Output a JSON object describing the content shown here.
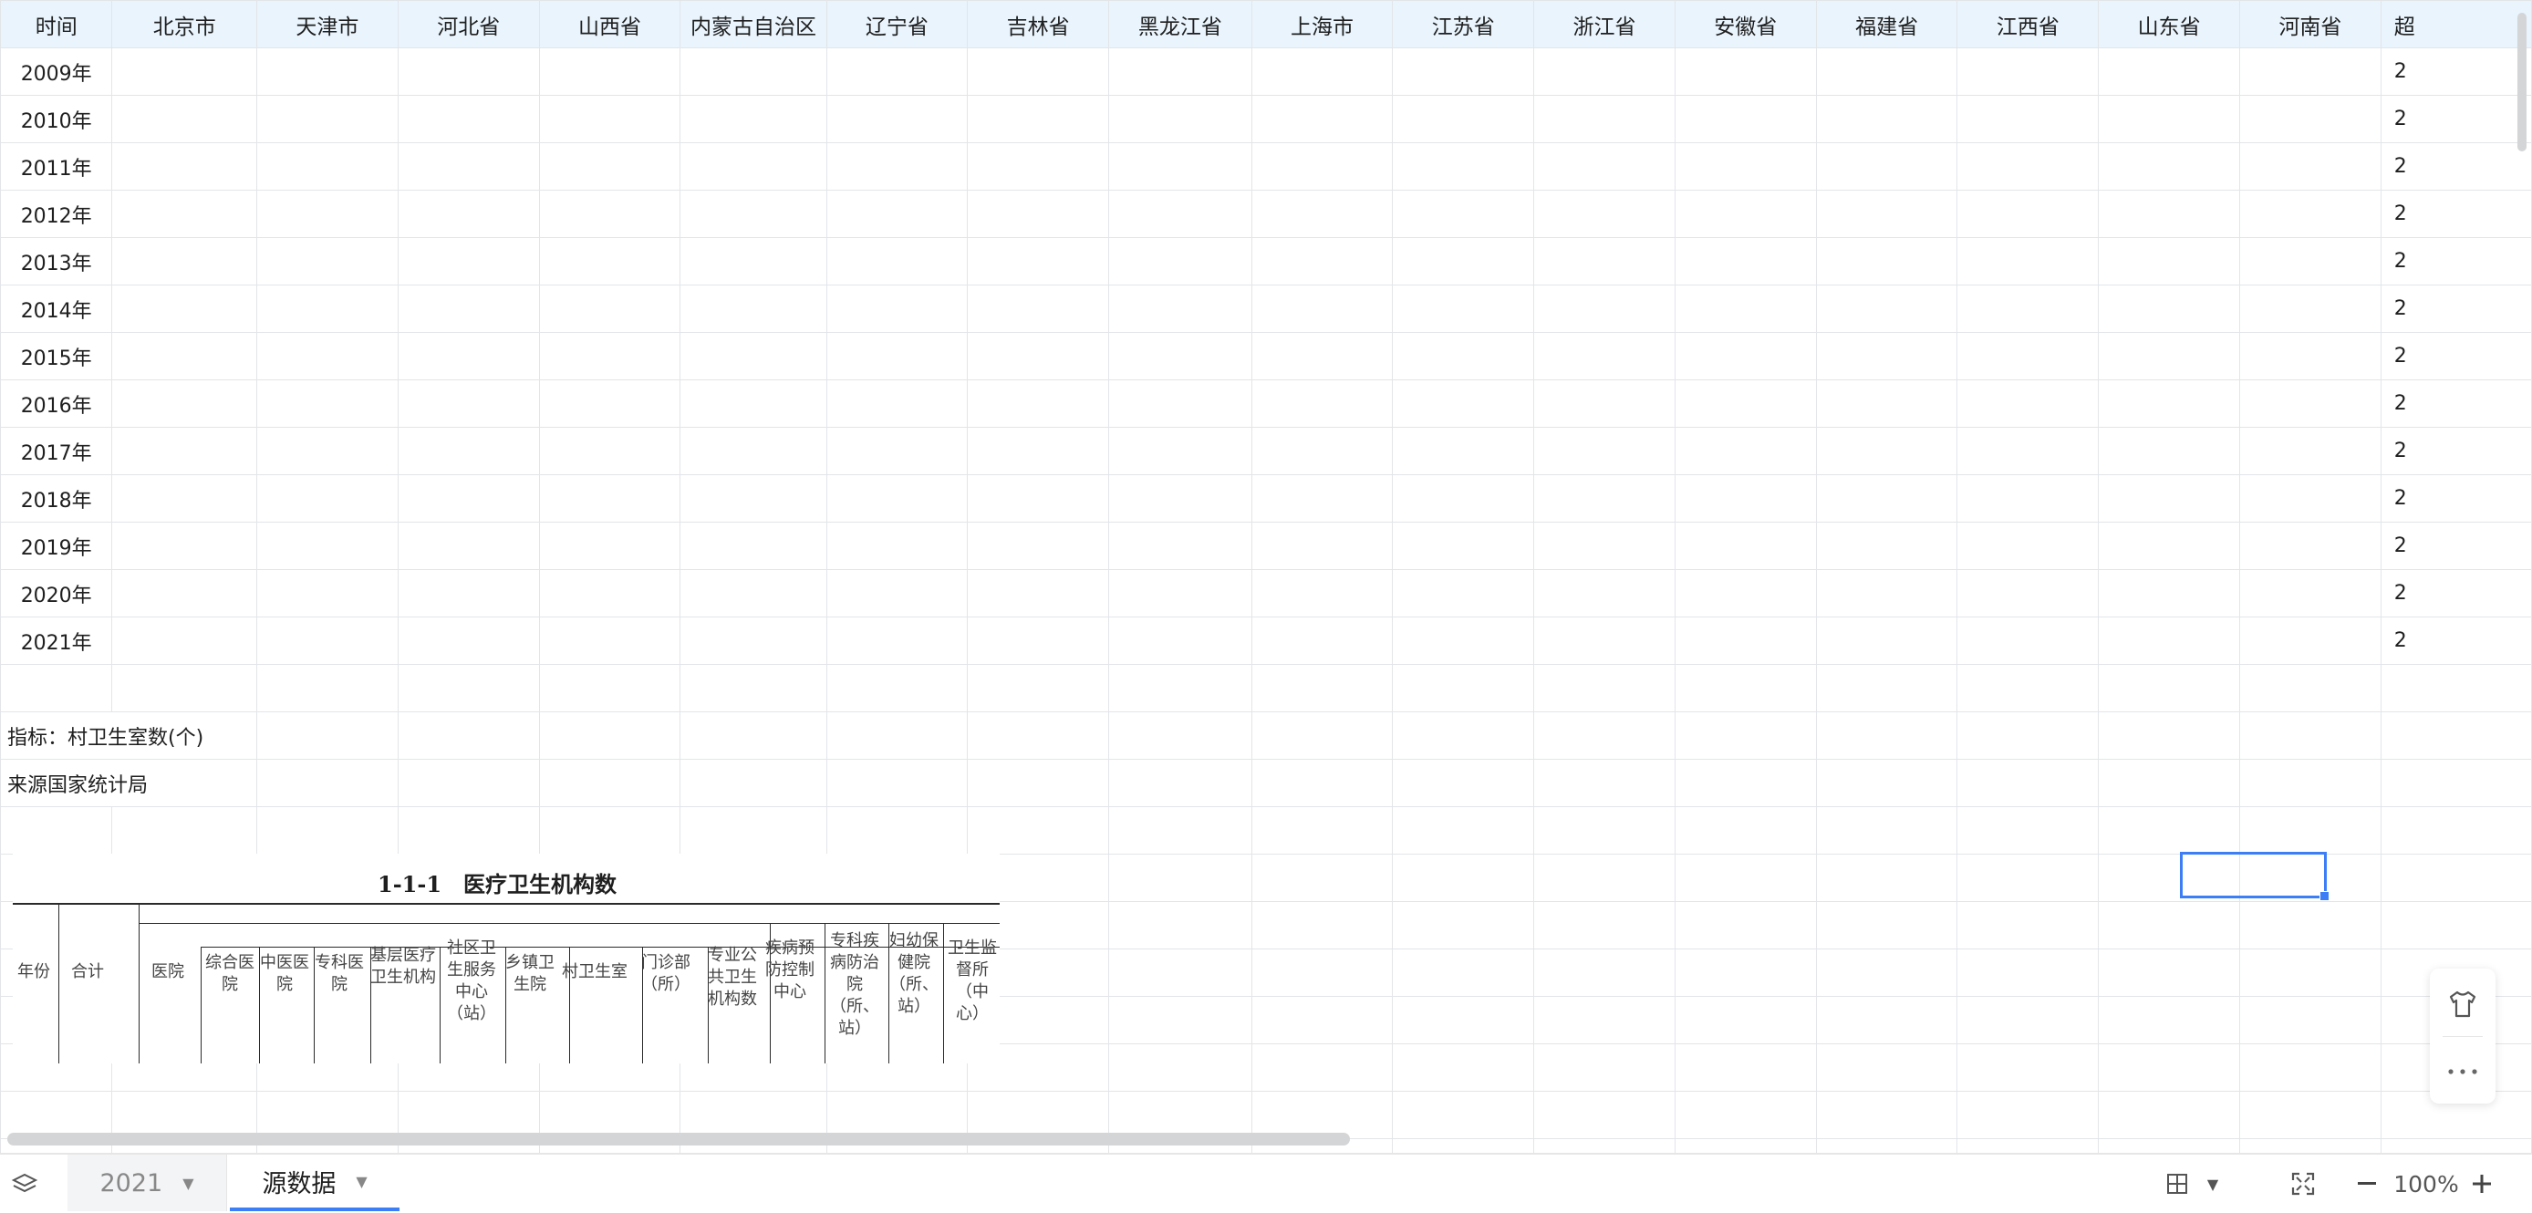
{
  "sheet": {
    "columns": [
      "时间",
      "北京市",
      "天津市",
      "河北省",
      "山西省",
      "内蒙古自治区",
      "辽宁省",
      "吉林省",
      "黑龙江省",
      "上海市",
      "江苏省",
      "浙江省",
      "安徽省",
      "福建省",
      "江西省",
      "山东省",
      "河南省",
      "超"
    ],
    "rows": [
      "2009年",
      "2010年",
      "2011年",
      "2012年",
      "2013年",
      "2014年",
      "2015年",
      "2016年",
      "2017年",
      "2018年",
      "2019年",
      "2020年",
      "2021年"
    ],
    "partial_values": [
      "2",
      "2",
      "2",
      "2",
      "2",
      "2",
      "2",
      "2",
      "2",
      "2",
      "2",
      "2",
      "2"
    ],
    "indicator_note": "指标：村卫生室数(个)",
    "source_note": "来源国家统计局"
  },
  "embedded_image": {
    "title": "1-1-1　医疗卫生机构数",
    "headers": [
      "年份",
      "合计",
      "医院",
      "综合医院",
      "中医医院",
      "专科医院",
      "基层医疗卫生机构",
      "社区卫生服务中心（站）",
      "乡镇卫生院",
      "村卫生室",
      "门诊部（所）",
      "专业公共卫生机构数",
      "疾病预防控制中心",
      "专科疾病防治院（所、站）",
      "妇幼保健院（所、站）",
      "卫生监督所（中心）"
    ]
  },
  "tabs": [
    {
      "label": "2021",
      "active": false
    },
    {
      "label": "源数据",
      "active": true
    }
  ],
  "status": {
    "zoom": "100%"
  },
  "icons": {
    "layers": "layers-icon",
    "shirt": "shirt-icon",
    "more": "more-icon",
    "grid": "grid-view-icon",
    "fullscreen": "fullscreen-icon",
    "zoom_out": "zoom-out-icon",
    "zoom_in": "zoom-in-icon"
  },
  "colors": {
    "header_bg": "#e9f4fd",
    "accent": "#3b7ef6",
    "grid_line": "#e3e5e8"
  }
}
